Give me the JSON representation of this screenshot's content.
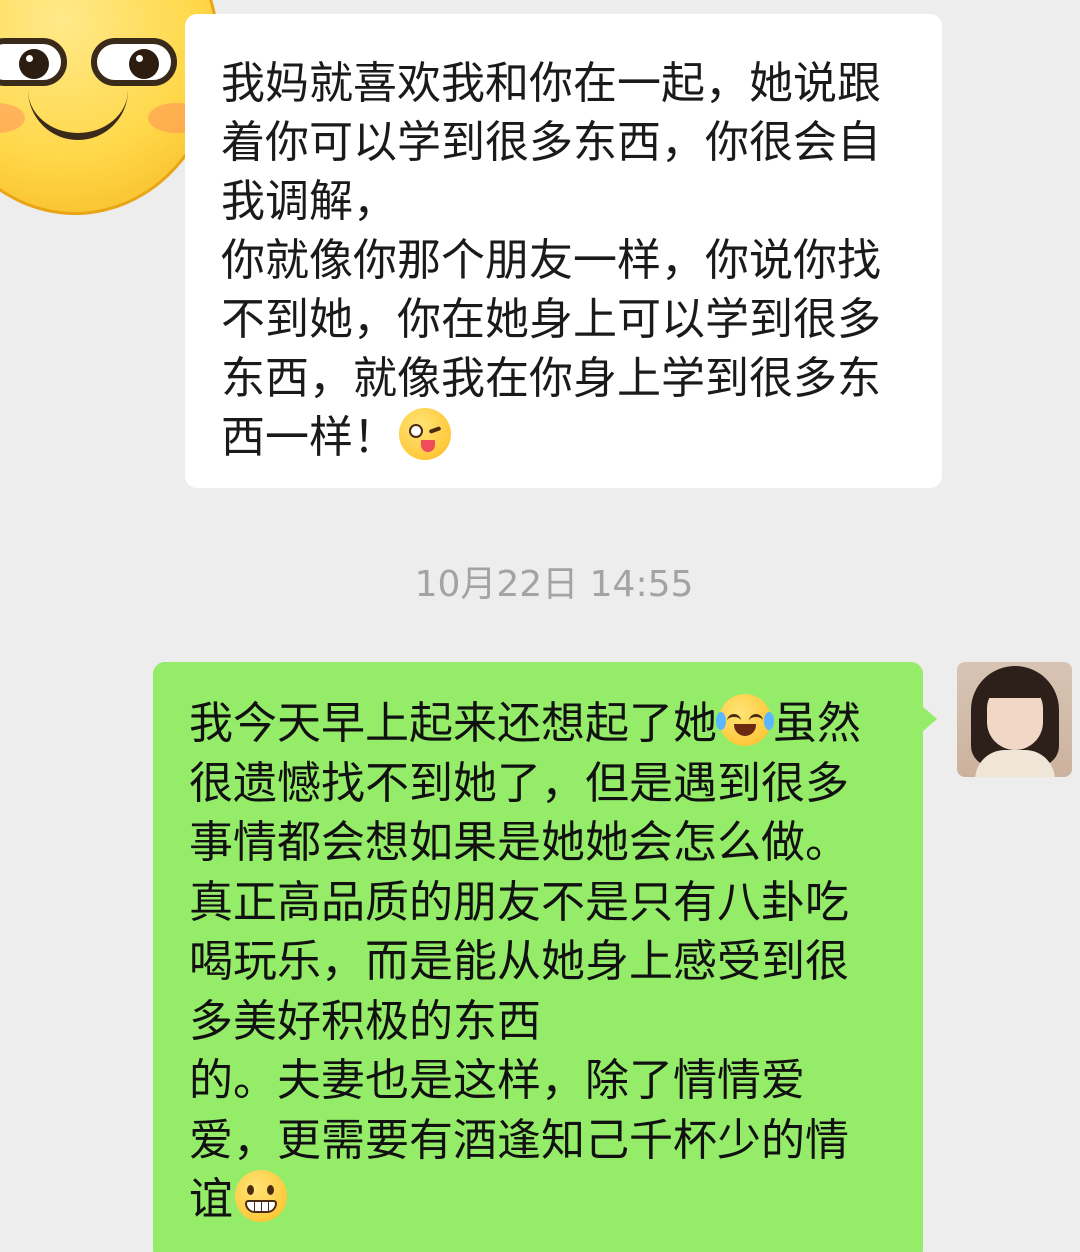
{
  "chat": {
    "incoming": {
      "avatar_icon": "smiley-face-avatar",
      "text": "我妈就喜欢我和你在一起，她说跟着你可以学到很多东西，你很会自我调解，\n你就像你那个朋友一样，你说你找不到她，你在她身上可以学到很多东西，就像我在你身上学到很多东西一样！",
      "emoji_icon": "wink-tongue-emoji"
    },
    "timestamp": "10月22日 14:55",
    "outgoing": {
      "avatar_icon": "user-photo-avatar",
      "text_1": "我今天早上起来还想起了她",
      "emoji_1_icon": "laugh-cry-emoji",
      "text_2": "虽然很遗憾找不到她了，但是遇到很多事情都会想如果是她她会怎么做。真正高品质的朋友不是只有八卦吃喝玩乐，而是能从她身上感受到很多美好积极的东西\n的。夫妻也是这样，除了情情爱爱，更需要有酒逢知己千杯少的情谊",
      "emoji_2_icon": "grin-emoji"
    }
  },
  "colors": {
    "background": "#ededed",
    "incoming_bubble": "#ffffff",
    "outgoing_bubble": "#95ec69",
    "timestamp_text": "#a3a3a3"
  }
}
